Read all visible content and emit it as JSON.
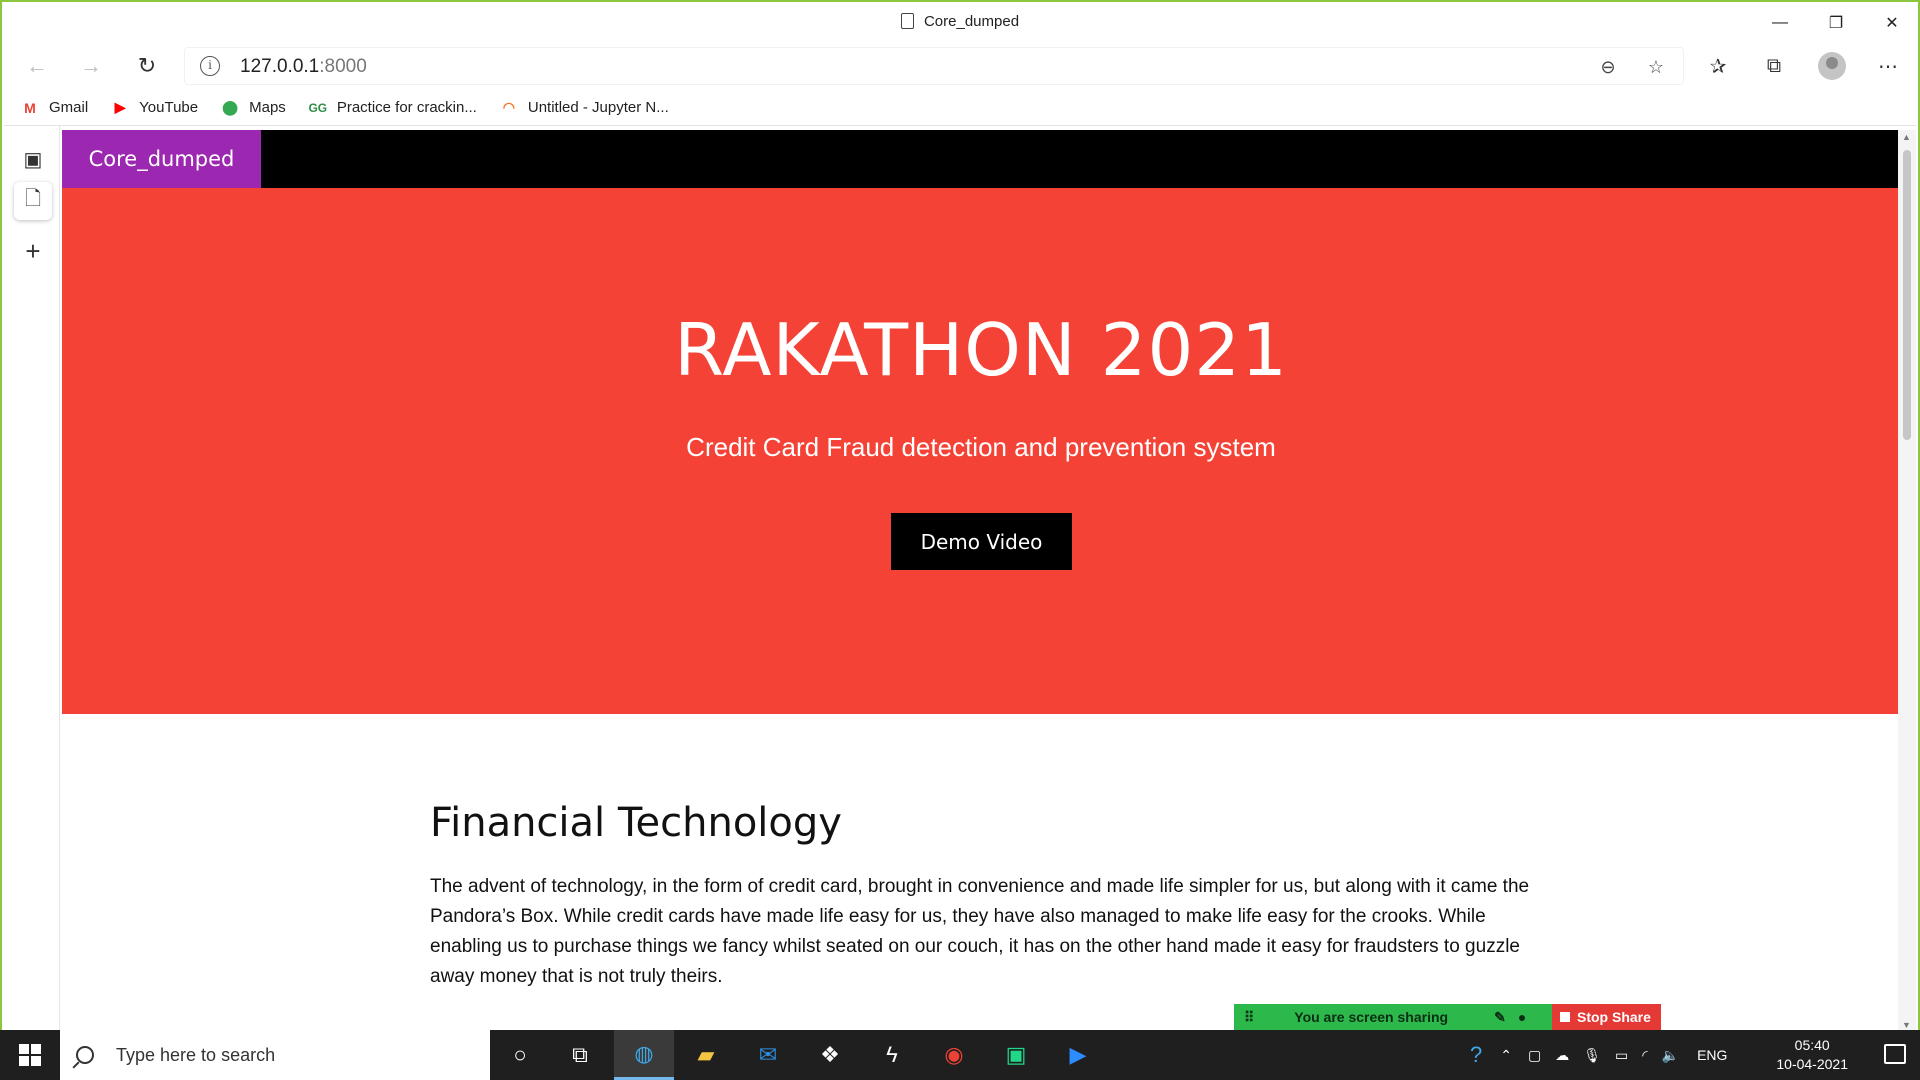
{
  "browser": {
    "window_title": "Core_dumped",
    "url_host": "127.0.0.1",
    "url_port": ":8000",
    "favorites": [
      {
        "label": "Gmail",
        "icon": "gmail-icon",
        "color": "#ea4335",
        "glyph": "M"
      },
      {
        "label": "YouTube",
        "icon": "youtube-icon",
        "color": "#ff0000",
        "glyph": "▶"
      },
      {
        "label": "Maps",
        "icon": "maps-icon",
        "color": "#34a853",
        "glyph": "⬤"
      },
      {
        "label": "Practice for crackin...",
        "icon": "geeksforgeeks-icon",
        "color": "#2f8d46",
        "glyph": "GG"
      },
      {
        "label": "Untitled - Jupyter N...",
        "icon": "jupyter-icon",
        "color": "#f37626",
        "glyph": "◠"
      }
    ]
  },
  "site": {
    "brand": "Core_dumped",
    "hero_title": "RAKATHON 2021",
    "hero_subtitle": "Credit Card Fraud detection and prevention system",
    "demo_button": "Demo Video",
    "section_title": "Financial Technology",
    "section_body": "The advent of technology, in the form of credit card, brought in convenience and made life simpler for us, but along with it came the Pandora’s Box. While credit cards have made life easy for us, they have also managed to make life easy for the crooks. While enabling us to purchase things we fancy whilst seated on our couch, it has on the other hand made it easy for fraudsters to guzzle away money that is not truly theirs.",
    "colors": {
      "nav": "#000000",
      "brand_bg": "#9c27b0",
      "hero_bg": "#f44336",
      "button_bg": "#000000"
    }
  },
  "screen_share": {
    "status": "You are screen sharing",
    "stop_label": "Stop Share"
  },
  "taskbar": {
    "search_placeholder": "Type here to search",
    "language": "ENG",
    "time": "05:40",
    "date": "10-04-2021"
  }
}
